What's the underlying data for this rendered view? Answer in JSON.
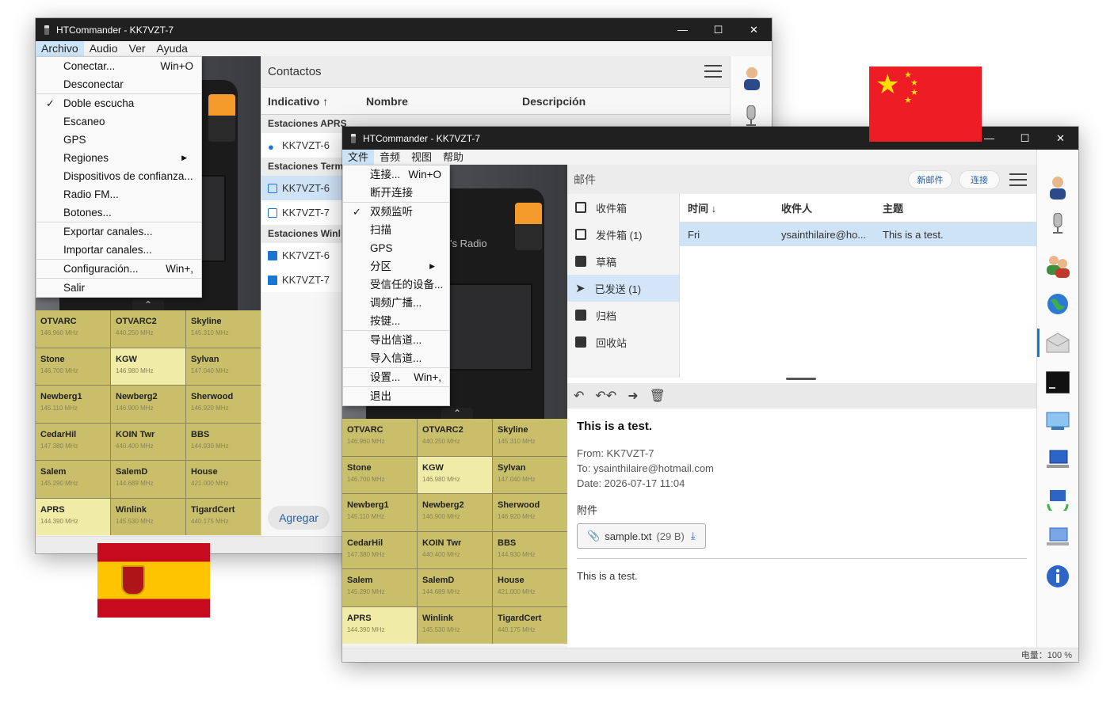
{
  "window_es": {
    "title": "HTCommander - KK7VZT-7",
    "menu": [
      "Archivo",
      "Audio",
      "Ver",
      "Ayuda"
    ],
    "dropdown": [
      {
        "label": "Conectar...",
        "shortcut": "Win+O"
      },
      {
        "label": "Desconectar"
      },
      {
        "sep": true
      },
      {
        "label": "Doble escucha",
        "checked": true
      },
      {
        "label": "Escaneo"
      },
      {
        "label": "GPS"
      },
      {
        "label": "Regiones",
        "submenu": true
      },
      {
        "label": "Dispositivos de confianza..."
      },
      {
        "label": "Radio FM..."
      },
      {
        "label": "Botones..."
      },
      {
        "sep": true
      },
      {
        "label": "Exportar canales..."
      },
      {
        "label": "Importar canales..."
      },
      {
        "sep": true
      },
      {
        "label": "Configuración...",
        "shortcut": "Win+,"
      },
      {
        "sep": true
      },
      {
        "label": "Salir"
      }
    ],
    "contacts": {
      "title": "Contactos",
      "columns": [
        "Indicativo ↑",
        "Nombre",
        "Descripción"
      ],
      "groups": [
        {
          "label": "Estaciones APRS",
          "rows": [
            {
              "callsign": "KK7VZT-6",
              "icon": "location-pin-icon"
            }
          ]
        },
        {
          "label": "Estaciones Term",
          "rows": [
            {
              "callsign": "KK7VZT-6",
              "icon": "terminal-icon",
              "selected": true
            },
            {
              "callsign": "KK7VZT-7",
              "icon": "terminal-icon"
            }
          ]
        },
        {
          "label": "Estaciones Winl",
          "rows": [
            {
              "callsign": "KK7VZT-6",
              "icon": "mail-icon"
            },
            {
              "callsign": "KK7VZT-7",
              "icon": "mail-icon"
            }
          ]
        }
      ],
      "add_button": "Agregar"
    }
  },
  "window_zh": {
    "title": "HTCommander - KK7VZT-7",
    "menu": [
      "文件",
      "音频",
      "视图",
      "帮助"
    ],
    "radio_label": "'s Radio",
    "dropdown": [
      {
        "label": "连接...",
        "shortcut": "Win+O"
      },
      {
        "label": "断开连接"
      },
      {
        "sep": true
      },
      {
        "label": "双频监听",
        "checked": true
      },
      {
        "label": "扫描"
      },
      {
        "label": "GPS"
      },
      {
        "label": "分区",
        "submenu": true
      },
      {
        "label": "受信任的设备..."
      },
      {
        "label": "调频广播..."
      },
      {
        "label": "按键..."
      },
      {
        "sep": true
      },
      {
        "label": "导出信道..."
      },
      {
        "label": "导入信道..."
      },
      {
        "sep": true
      },
      {
        "label": "设置...",
        "shortcut": "Win+,"
      },
      {
        "sep": true
      },
      {
        "label": "退出"
      }
    ],
    "mail": {
      "title": "邮件",
      "new_button": "新邮件",
      "connect_button": "连接",
      "folders": [
        {
          "label": "收件箱"
        },
        {
          "label": "发件箱 (1)"
        },
        {
          "label": "草稿"
        },
        {
          "label": "已发送 (1)",
          "selected": true
        },
        {
          "label": "归档"
        },
        {
          "label": "回收站"
        }
      ],
      "columns": [
        "时间 ↓",
        "收件人",
        "主题"
      ],
      "rows": [
        {
          "time": "Fri",
          "to": "ysainthilaire@ho...",
          "subject": "This is a test."
        }
      ],
      "preview": {
        "subject": "This is a test.",
        "from": "From: KK7VZT-7",
        "to": "To: ysainthilaire@hotmail.com",
        "date": "Date: 2026-07-17 11:04",
        "attachments_label": "附件",
        "attachment_name": "sample.txt",
        "attachment_size": "(29 B)",
        "body": "This is a test."
      }
    },
    "status": "电量：100 %"
  },
  "channels": [
    {
      "name": "OTVARC",
      "freq": "146.960 MHz"
    },
    {
      "name": "OTVARC2",
      "freq": "440.250 MHz"
    },
    {
      "name": "Skyline",
      "freq": "145.310 MHz"
    },
    {
      "name": "Stone",
      "freq": "146.700 MHz"
    },
    {
      "name": "KGW",
      "freq": "146.980 MHz",
      "highlight": true
    },
    {
      "name": "Sylvan",
      "freq": "147.040 MHz"
    },
    {
      "name": "Newberg1",
      "freq": "145.110 MHz"
    },
    {
      "name": "Newberg2",
      "freq": "146.900 MHz"
    },
    {
      "name": "Sherwood",
      "freq": "146.920 MHz"
    },
    {
      "name": "CedarHil",
      "freq": "147.380 MHz"
    },
    {
      "name": "KOIN Twr",
      "freq": "440.400 MHz"
    },
    {
      "name": "BBS",
      "freq": "144.930 MHz"
    },
    {
      "name": "Salem",
      "freq": "145.290 MHz"
    },
    {
      "name": "SalemD",
      "freq": "144.689 MHz"
    },
    {
      "name": "House",
      "freq": "421.000 MHz"
    },
    {
      "name": "APRS",
      "freq": "144.390 MHz",
      "highlight": true
    },
    {
      "name": "Winlink",
      "freq": "145.530 MHz"
    },
    {
      "name": "TigardCert",
      "freq": "440.175 MHz"
    }
  ],
  "colors": {
    "channel_bg": "#c9bf6a",
    "channel_highlight": "#f1eba8",
    "selection": "#cfe3f7",
    "accent": "#1976d2",
    "cn_flag_red": "#ee1c25",
    "cn_flag_star": "#ffde00",
    "es_flag_red": "#c60b1e",
    "es_flag_yellow": "#ffc400"
  }
}
